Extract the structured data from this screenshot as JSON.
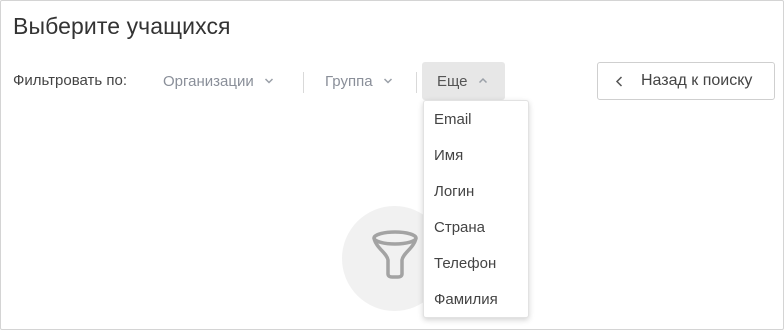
{
  "page": {
    "title": "Выберите учащихся"
  },
  "filters": {
    "label": "Фильтровать по:",
    "organization": {
      "label": "Организации",
      "icon": "chevron-down-icon"
    },
    "group": {
      "label": "Группа",
      "icon": "chevron-down-icon"
    },
    "more": {
      "label": "Еще",
      "icon": "chevron-up-icon",
      "expanded": true
    }
  },
  "back_button": {
    "label": "Назад к поиску",
    "icon": "chevron-left-icon"
  },
  "more_menu": {
    "items": [
      {
        "label": "Email"
      },
      {
        "label": "Имя"
      },
      {
        "label": "Логин"
      },
      {
        "label": "Страна"
      },
      {
        "label": "Телефон"
      },
      {
        "label": "Фамилия"
      }
    ]
  },
  "empty_state": {
    "icon": "funnel-icon"
  },
  "colors": {
    "muted_text": "#8a8f99",
    "active_filter_bg": "#e7e7e7",
    "empty_circle_bg": "#f1f1f1",
    "border": "#d4d4d4"
  }
}
